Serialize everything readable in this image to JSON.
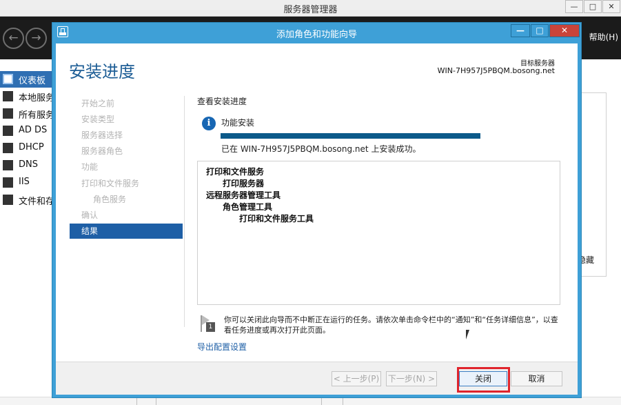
{
  "server_manager": {
    "title": "服务器管理器",
    "window_controls": [
      "—",
      "□",
      "✕"
    ],
    "help_menu": "帮助(H)",
    "nav_items": [
      {
        "label": "仪表板",
        "icon": "dashboard-icon",
        "active": true
      },
      {
        "label": "本地服务",
        "icon": "server-icon",
        "active": false
      },
      {
        "label": "所有服务",
        "icon": "servers-icon",
        "active": false
      },
      {
        "label": "AD DS",
        "icon": "ad-ds-icon",
        "active": false
      },
      {
        "label": "DHCP",
        "icon": "dhcp-icon",
        "active": false
      },
      {
        "label": "DNS",
        "icon": "dns-icon",
        "active": false
      },
      {
        "label": "IIS",
        "icon": "iis-icon",
        "active": false
      },
      {
        "label": "文件和存",
        "icon": "file-storage-icon",
        "active": false
      }
    ],
    "right_panel_text": "隐藏"
  },
  "wizard": {
    "title": "添加角色和功能向导",
    "window_controls": {
      "minimize": "—",
      "maximize": "□",
      "close": "✕"
    },
    "heading": "安装进度",
    "destination_label": "目标服务器",
    "destination_server": "WIN-7H957J5PBQM.bosong.net",
    "steps": [
      {
        "label": "开始之前",
        "sub": false,
        "active": false
      },
      {
        "label": "安装类型",
        "sub": false,
        "active": false
      },
      {
        "label": "服务器选择",
        "sub": false,
        "active": false
      },
      {
        "label": "服务器角色",
        "sub": false,
        "active": false
      },
      {
        "label": "功能",
        "sub": false,
        "active": false
      },
      {
        "label": "打印和文件服务",
        "sub": false,
        "active": false
      },
      {
        "label": "角色服务",
        "sub": true,
        "active": false
      },
      {
        "label": "确认",
        "sub": false,
        "active": false
      },
      {
        "label": "结果",
        "sub": false,
        "active": true
      }
    ],
    "content_title": "查看安装进度",
    "install_label": "功能安装",
    "progress": 1.0,
    "status": "已在 WIN-7H957J5PBQM.bosong.net 上安装成功。",
    "results": [
      {
        "text": "打印和文件服务",
        "level": 0
      },
      {
        "text": "打印服务器",
        "level": 1
      },
      {
        "text": "远程服务器管理工具",
        "level": 0
      },
      {
        "text": "角色管理工具",
        "level": 1
      },
      {
        "text": "打印和文件服务工具",
        "level": 2
      }
    ],
    "note_badge": "1",
    "note": "你可以关闭此向导而不中断正在运行的任务。请依次单击命令栏中的“通知”和“任务详细信息”，以查看任务进度或再次打开此页面。",
    "export_link": "导出配置设置",
    "buttons": {
      "prev": "< 上一步(P)",
      "next": "下一步(N) >",
      "close": "关闭",
      "cancel": "取消"
    },
    "colors": {
      "title_bar": "#3ea0d7",
      "heading": "#1e5e96",
      "active_step": "#1e5fa6",
      "progress_fill": "#0c5a8a",
      "highlight": "#e0242c"
    }
  }
}
